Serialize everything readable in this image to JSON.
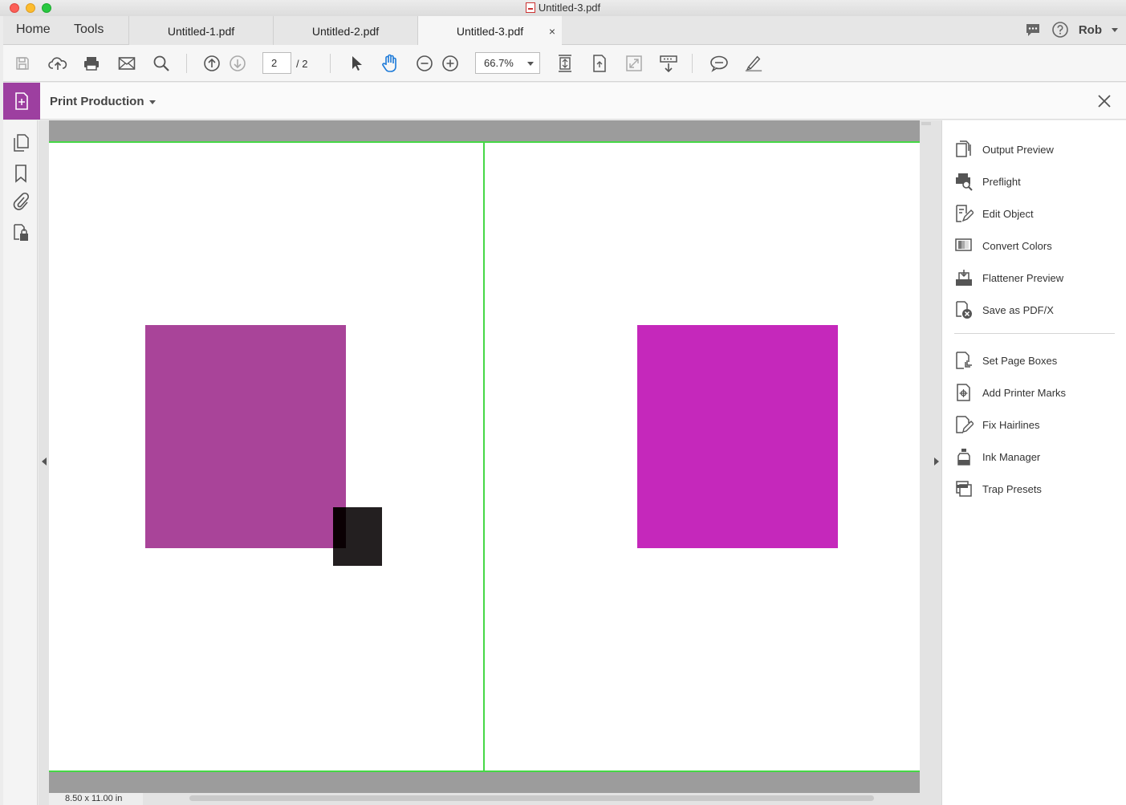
{
  "window": {
    "title": "Untitled-3.pdf"
  },
  "nav": {
    "home": "Home",
    "tools": "Tools"
  },
  "tabs": [
    {
      "label": "Untitled-1.pdf"
    },
    {
      "label": "Untitled-2.pdf"
    },
    {
      "label": "Untitled-3.pdf",
      "active": true
    }
  ],
  "tab_close": "×",
  "user": {
    "name": "Rob"
  },
  "toolbar": {
    "page_current": "2",
    "page_total": "/ 2",
    "zoom": "66.7%"
  },
  "tool_panel": {
    "title": "Print Production"
  },
  "document": {
    "page_size": "8.50 x 11.00 in",
    "colors": {
      "left_square": "#a94499",
      "right_square": "#c528bb",
      "dark_square": "#231f20",
      "trim_line": "#46d846"
    }
  },
  "print_production": {
    "group1": [
      {
        "label": "Output Preview",
        "icon": "output-preview-icon"
      },
      {
        "label": "Preflight",
        "icon": "preflight-icon"
      },
      {
        "label": "Edit Object",
        "icon": "edit-object-icon"
      },
      {
        "label": "Convert Colors",
        "icon": "convert-colors-icon"
      },
      {
        "label": "Flattener Preview",
        "icon": "flattener-preview-icon"
      },
      {
        "label": "Save as PDF/X",
        "icon": "save-pdfx-icon"
      }
    ],
    "group2": [
      {
        "label": "Set Page Boxes",
        "icon": "set-page-boxes-icon"
      },
      {
        "label": "Add Printer Marks",
        "icon": "add-printer-marks-icon"
      },
      {
        "label": "Fix Hairlines",
        "icon": "fix-hairlines-icon"
      },
      {
        "label": "Ink Manager",
        "icon": "ink-manager-icon"
      },
      {
        "label": "Trap Presets",
        "icon": "trap-presets-icon"
      }
    ]
  }
}
